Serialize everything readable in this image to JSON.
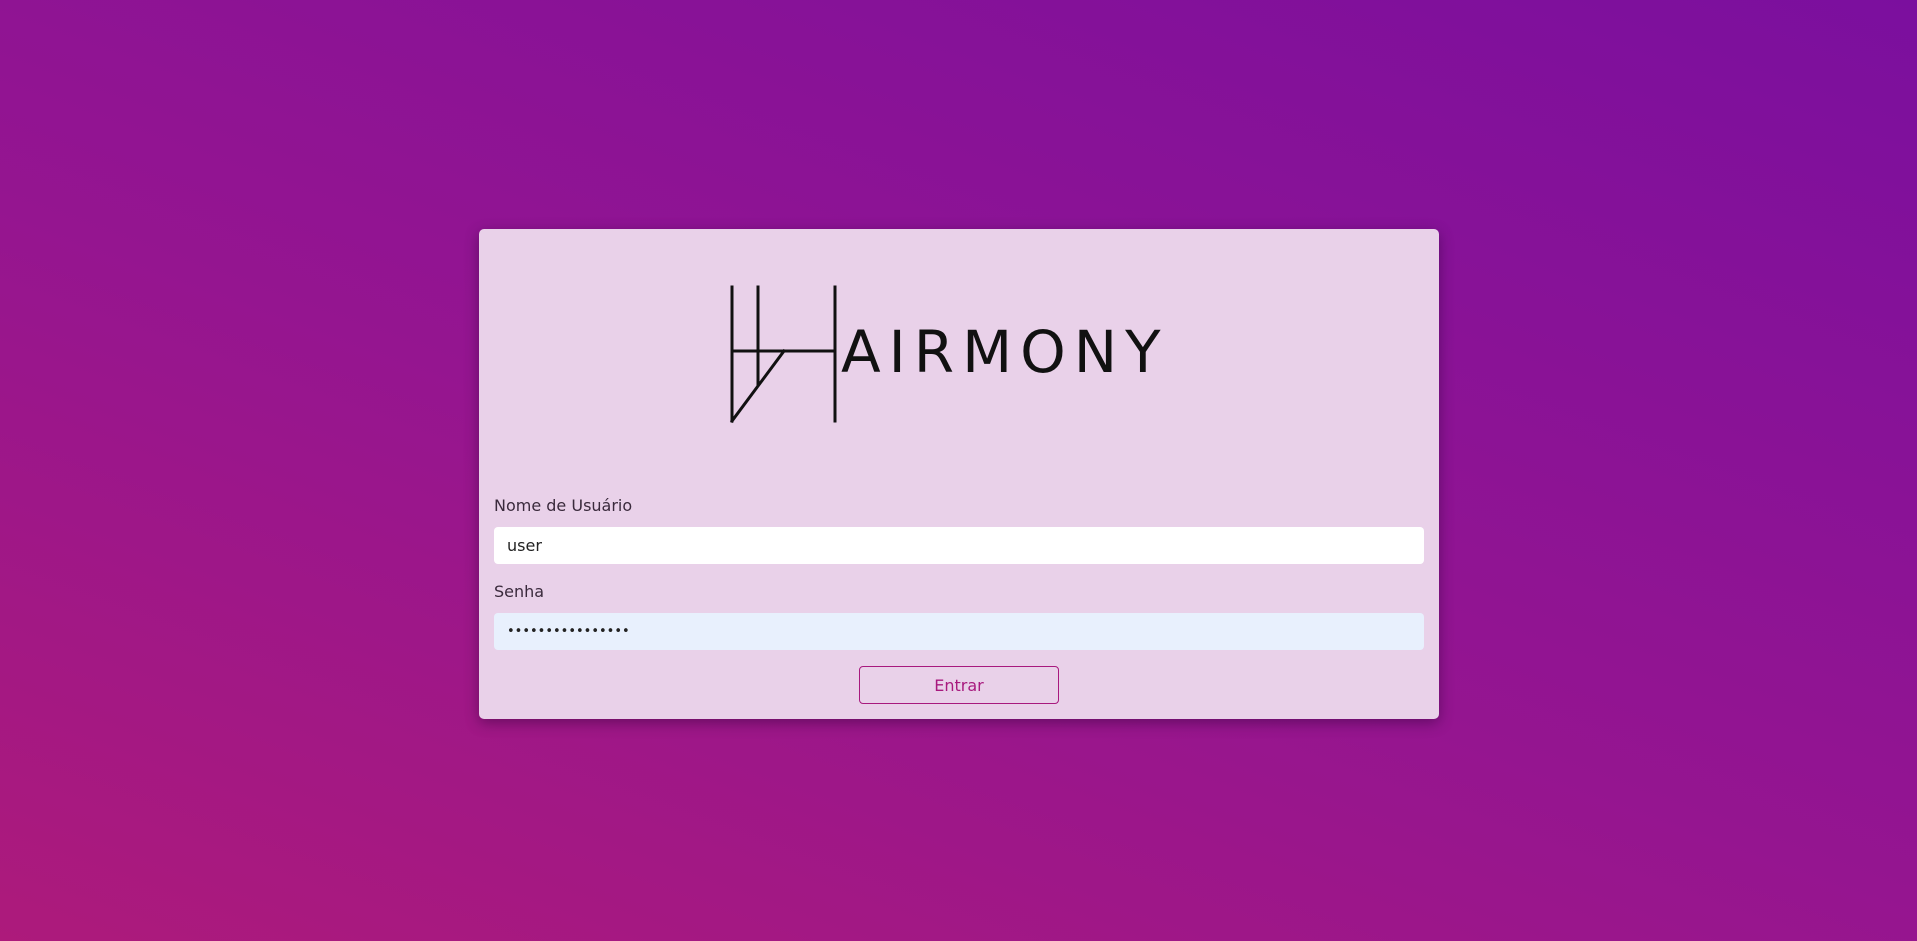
{
  "logo": {
    "wordmark": "AIRMONY",
    "letter_icon": "H-monogram-icon"
  },
  "form": {
    "username_label": "Nome de Usuário",
    "username_value": "user",
    "password_label": "Senha",
    "password_value": "••••••••••••••••",
    "submit_label": "Entrar"
  },
  "colors": {
    "background_gradient": [
      "#ad1a7b",
      "#7b0f9e"
    ],
    "card": "#e9d1e9",
    "accent": "#a8197e",
    "autofill_input": "#e8f0fd"
  }
}
